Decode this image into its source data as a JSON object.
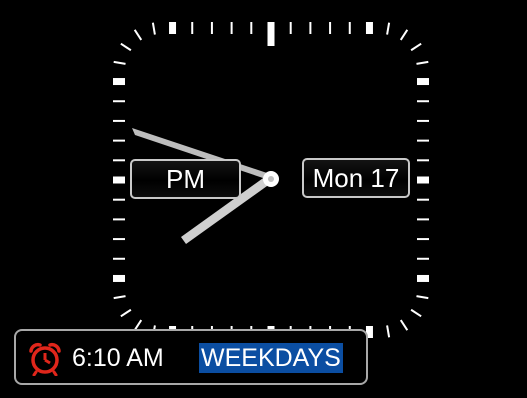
{
  "clock": {
    "hour_hand_target": "PM",
    "date_label": "Mon 17",
    "ampm_label": "PM"
  },
  "alarm": {
    "time": "6:10 AM",
    "repeat": "WEEKDAYS",
    "icon": "alarm-clock-icon",
    "repeat_highlight_color": "#0b4ea2",
    "icon_color": "#e0261b"
  },
  "colors": {
    "background": "#000000",
    "hands": "#e6e6e6",
    "ticks": "#ffffff"
  }
}
